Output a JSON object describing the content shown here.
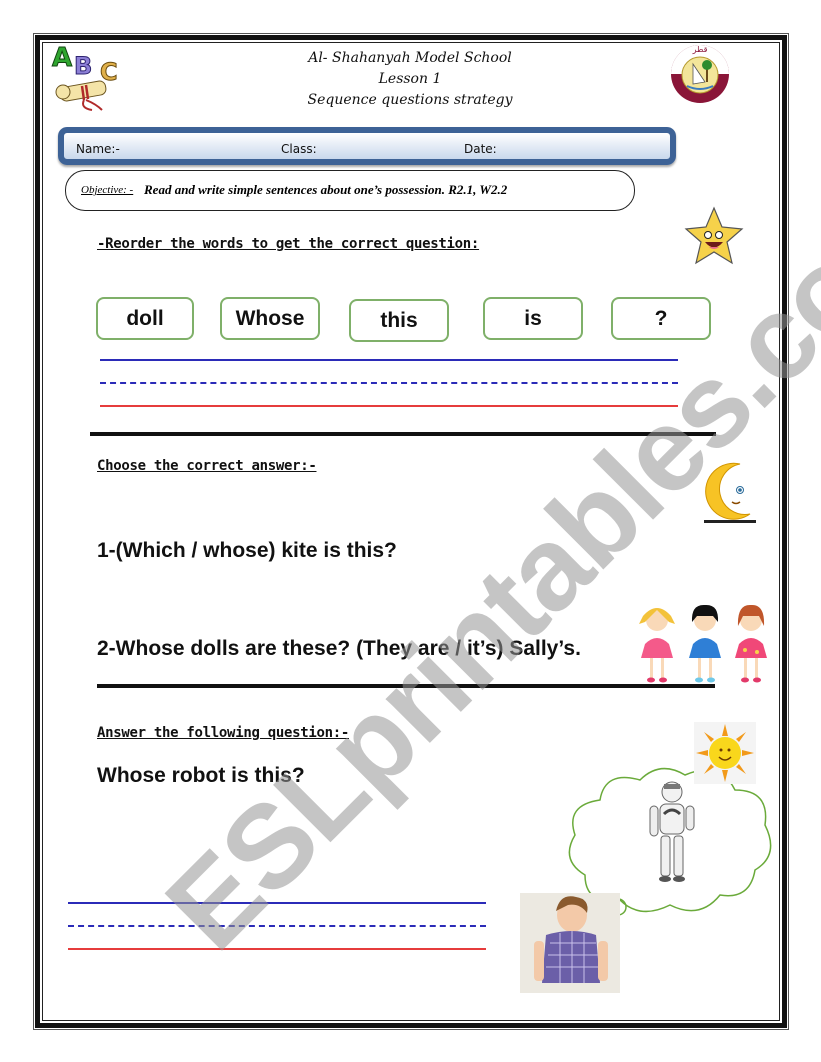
{
  "header": {
    "school": "Al- Shahanyah Model School",
    "lesson": "Lesson 1",
    "topic": "Sequence questions strategy",
    "left_logo": "abc-scroll-icon",
    "right_logo": "qatar-ministry-emblem"
  },
  "info_band": {
    "name_label": "Name:-",
    "class_label": "Class:",
    "date_label": "Date:"
  },
  "objective": {
    "label": "Objective: -",
    "text": "Read and write simple sentences about one’s possession.  R2.1, W2.2"
  },
  "section1": {
    "heading": "-Reorder the words to get the correct question:",
    "words": [
      "doll",
      "Whose",
      "this",
      "is",
      "?"
    ],
    "icon": "smiling-star-icon"
  },
  "section2": {
    "heading": "Choose the correct answer:-",
    "questions": [
      "1-(Which / whose) kite is this?",
      "2-Whose dolls are these? (They are / it’s) Sally’s."
    ],
    "icons": [
      "crescent-moon-icon",
      "three-dolls-icon"
    ]
  },
  "section3": {
    "heading": "Answer the following question:-",
    "question": "Whose robot is this?",
    "icons": [
      "sun-icon",
      "robot-icon",
      "thought-cloud",
      "boy-photo"
    ]
  },
  "watermark": "ESLprintables.com",
  "colors": {
    "band_border": "#3d6296",
    "word_box_border": "#7fb069",
    "writing_line_blue": "#2b2bb8",
    "writing_line_red": "#e63c3c",
    "cloud_stroke": "#6aaa3a"
  }
}
